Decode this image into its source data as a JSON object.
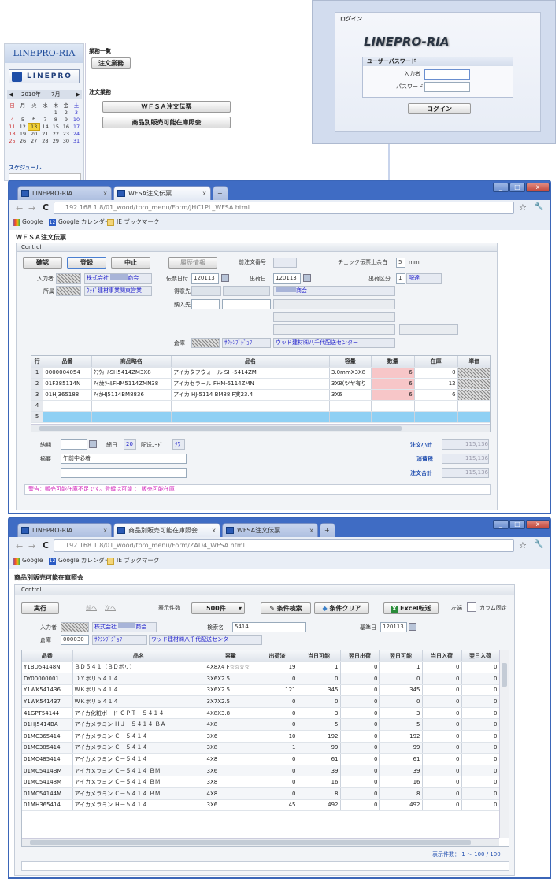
{
  "menu": {
    "brand": "LINEPRO-RIA",
    "logo_text": "LINEPRO",
    "calendar": {
      "year": "2010年",
      "month": "7月",
      "weekdays": [
        "日",
        "月",
        "火",
        "水",
        "木",
        "金",
        "土"
      ],
      "weeks": [
        [
          "",
          "",
          "",
          "",
          "1",
          "2",
          "3"
        ],
        [
          "4",
          "5",
          "6",
          "7",
          "8",
          "9",
          "10"
        ],
        [
          "11",
          "12",
          "13",
          "14",
          "15",
          "16",
          "17"
        ],
        [
          "18",
          "19",
          "20",
          "21",
          "22",
          "23",
          "24"
        ],
        [
          "25",
          "26",
          "27",
          "28",
          "29",
          "30",
          "31"
        ]
      ],
      "today": "13"
    },
    "schedule_label": "スケジュール",
    "section1": "業務一覧",
    "section1_button": "注文業務",
    "section2": "注文業務",
    "section2_buttons": [
      "ＷＦＳＡ注文伝票",
      "商品別販売可能在庫照会"
    ]
  },
  "login": {
    "title": "ログイン",
    "logo": "LINEPRO-RIA",
    "group_title": "ユーザーパスワード",
    "user_label": "入力者",
    "pass_label": "パスワード",
    "button": "ログイン"
  },
  "win1": {
    "tabs": [
      "LINEPRO-RIA",
      "WFSA注文伝票"
    ],
    "url": "192.168.1.8/01_wood/tpro_menu/Form/JHC1PL_WFSA.html",
    "bookmarks": [
      "Google",
      "Google カレンダー",
      "IE ブックマーク"
    ],
    "calendar_icon_num": "12",
    "title": "ＷＦＳＡ注文伝票",
    "control": "Control",
    "buttons": {
      "confirm": "確認",
      "register": "登録",
      "cancel": "中止",
      "history": "履歴情報"
    },
    "labels": {
      "prev_order": "前注文番号",
      "check_remain": "チェック伝票上余白",
      "mm": "mm",
      "check_value": "5",
      "inputter": "入力者",
      "company": "株式会社 ",
      "company_suffix": "商会",
      "dept": "所属",
      "dept_value": "ｳｯﾄﾞ建材事業関東営業",
      "slip_date": "伝票日付",
      "slip_date_value": "120113",
      "ship_date": "出荷日",
      "ship_date_value": "120113",
      "ship_type": "出荷区分",
      "ship_type_code": "1",
      "ship_type_value": "配達",
      "customer": "得意先",
      "customer_suffix": "商会",
      "delivery": "納入先",
      "warehouse": "倉庫",
      "warehouse_kana": "ｻｸｼﾝﾌﾞｼﾞｮﾜ",
      "warehouse_name": "ウッド建材㈱八千代配送センター"
    },
    "grid": {
      "headers": [
        "行",
        "品番",
        "商品略名",
        "品名",
        "容量",
        "数量",
        "在庫",
        "単価"
      ],
      "rows": [
        [
          "1",
          "0000004054",
          "ｸﾌｳｫｰﾙSH5414ZM3X8",
          "アイカタフウォール SH-5414ZM",
          "3.0mmX3X8",
          "6",
          "0"
        ],
        [
          "2",
          "01F385114N",
          "ｱｲｶｾﾗｰﾙFHM5114ZMN38",
          "アイカセラール FHM-5114ZMN",
          "3X8(ツヤ有り",
          "6",
          "12"
        ],
        [
          "3",
          "01HJ365188",
          "ｱｲｶHJ5114BM8836",
          "アイカ HJ-5114 BM88 F実23.4",
          "3X6",
          "6",
          "6"
        ],
        [
          "4",
          "",
          "",
          "",
          "",
          "",
          ""
        ],
        [
          "5",
          "",
          "",
          "",
          "",
          "",
          ""
        ]
      ]
    },
    "bottom": {
      "deadline": "納期",
      "days": "締日",
      "days_value": "20",
      "delivery_code": "配送ｺｰﾄﾞ",
      "delivery_code_value": "ｸﾜ",
      "remark": "摘要",
      "remark_value": "午前中必着",
      "subtotal": "注文小計",
      "tax": "消費税",
      "total": "注文合計",
      "amount": "115,136"
    },
    "status": "警告：販売可能在庫不足です。登録は可能 ： 販売可能在庫"
  },
  "win2": {
    "tabs": [
      "LINEPRO-RIA",
      "商品別販売可能在庫照会",
      "WFSA注文伝票"
    ],
    "url": "192.168.1.8/01_wood/tpro_menu/Form/ZAD4_WFSA.html",
    "title": "商品別販売可能在庫照会",
    "control": "Control",
    "toolbar": {
      "run": "実行",
      "prev": "前へ",
      "next": "次へ",
      "count_label": "表示件数",
      "count_value": "500件",
      "search": "条件検索",
      "clear": "条件クリア",
      "excel": "Excel転送",
      "left": "左端",
      "fix": "カラム固定"
    },
    "labels": {
      "inputter": "入力者",
      "company": "株式会社 ",
      "company_suffix": "商会",
      "search": "検索名",
      "search_value": "5414",
      "base_date": "基準日",
      "base_date_value": "120113",
      "warehouse": "倉庫",
      "warehouse_code": "000030",
      "warehouse_kana": "ｻｸｼﾝﾌﾞｼﾞｮﾜ",
      "warehouse_name": "ウッド建材㈱八千代配送センター"
    },
    "grid": {
      "headers": [
        "品番",
        "品名",
        "容量",
        "出荷済",
        "当日可能",
        "翌日出荷",
        "翌日可能",
        "当日入荷",
        "翌日入荷"
      ],
      "rows": [
        [
          "Y1BD54148N",
          "ＢＤ５４１（ＢＤボリ）",
          "4X8X4 F☆☆☆☆",
          "19",
          "1",
          "0",
          "1",
          "0",
          "0"
        ],
        [
          "DY00000001",
          "ＤＹボリ５４１４",
          "3X6X2.5",
          "0",
          "0",
          "0",
          "0",
          "0",
          "0"
        ],
        [
          "Y1WK541436",
          "ＷＫボリ５４１４",
          "3X6X2.5",
          "121",
          "345",
          "0",
          "345",
          "0",
          "0"
        ],
        [
          "Y1WK541437",
          "ＷＫボリ５４１４",
          "3X7X2.5",
          "0",
          "0",
          "0",
          "0",
          "0",
          "0"
        ],
        [
          "41GPT54144",
          "アイカ化粧ボード ＧＰＴ－５４１４",
          "4X8X3.8",
          "0",
          "3",
          "0",
          "3",
          "0",
          "0"
        ],
        [
          "01HJ5414BA",
          "アイカメラミン ＨＪ－５４１４ ＢＡ",
          "4X8",
          "0",
          "5",
          "0",
          "5",
          "0",
          "0"
        ],
        [
          "01MC365414",
          "アイカメラミン Ｃ－５４１４",
          "3X6",
          "10",
          "192",
          "0",
          "192",
          "0",
          "0"
        ],
        [
          "01MC385414",
          "アイカメラミン Ｃ－５４１４",
          "3X8",
          "1",
          "99",
          "0",
          "99",
          "0",
          "0"
        ],
        [
          "01MC485414",
          "アイカメラミン Ｃ－５４１４",
          "4X8",
          "0",
          "61",
          "0",
          "61",
          "0",
          "0"
        ],
        [
          "01MC5414BM",
          "アイカメラミン Ｃ－５４１４ ＢＭ",
          "3X6",
          "0",
          "39",
          "0",
          "39",
          "0",
          "0"
        ],
        [
          "01MC54148M",
          "アイカメラミン Ｃ－５４１４ ＢＭ",
          "3X8",
          "0",
          "16",
          "0",
          "16",
          "0",
          "0"
        ],
        [
          "01MC54144M",
          "アイカメラミン Ｃ－５４１４ ＢＭ",
          "4X8",
          "0",
          "8",
          "0",
          "8",
          "0",
          "0"
        ],
        [
          "01MH365414",
          "アイカメラミン Ｈ－５４１４",
          "3X6",
          "45",
          "492",
          "0",
          "492",
          "0",
          "0"
        ]
      ]
    },
    "status": "表示件数： 1 ～ 100 / 100"
  }
}
